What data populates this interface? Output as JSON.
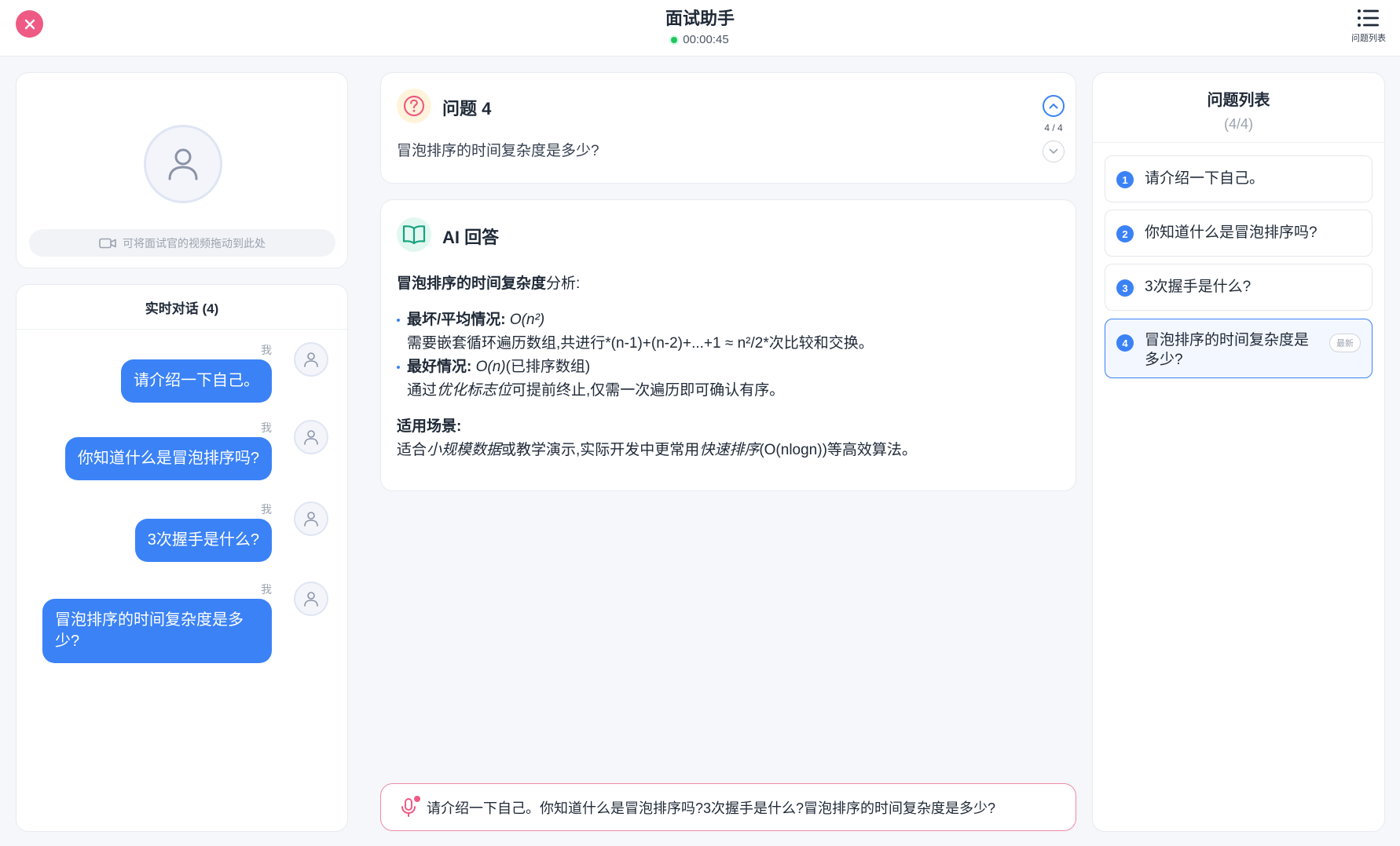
{
  "header": {
    "title": "面试助手",
    "timer": "00:00:45",
    "question_list_label": "问题列表"
  },
  "video": {
    "drag_hint": "可将面试官的视频拖动到此处"
  },
  "chat": {
    "title": "实时对话 (4)",
    "messages": [
      {
        "sender": "我",
        "text": "请介绍一下自己。"
      },
      {
        "sender": "我",
        "text": "你知道什么是冒泡排序吗?"
      },
      {
        "sender": "我",
        "text": "3次握手是什么?"
      },
      {
        "sender": "我",
        "text_line1": "冒泡排序的时间复杂度是多",
        "text_line2": "少?"
      }
    ]
  },
  "question": {
    "title": "问题 4",
    "text": "冒泡排序的时间复杂度是多少?",
    "position": "4 / 4"
  },
  "answer": {
    "title": "AI 回答",
    "intro_bold": "冒泡排序的时间复杂度",
    "intro_rest": "分析:",
    "worst_label": "最坏/平均情况:",
    "worst_value": "O(n²)",
    "worst_desc": "需要嵌套循环遍历数组,共进行*(n-1)+(n-2)+...+1 ≈ n²/2*次比较和交换。",
    "best_label": "最好情况:",
    "best_value": "O(n)",
    "best_note": "(已排序数组)",
    "best_desc_pre": "通过",
    "best_desc_em": "优化标志位",
    "best_desc_post": "可提前终止,仅需一次遍历即可确认有序。",
    "scene_label": "适用场景:",
    "scene_pre": "适合",
    "scene_em1": "小规模数据",
    "scene_mid": "或教学演示,实际开发中更常用",
    "scene_em2": "快速排序",
    "scene_post": "(O(nlogn))等高效算法。"
  },
  "transcript": {
    "text": "请介绍一下自己。你知道什么是冒泡排序吗?3次握手是什么?冒泡排序的时间复杂度是多少?"
  },
  "question_list": {
    "title": "问题列表",
    "count": "(4/4)",
    "items": [
      {
        "num": "1",
        "label": "请介绍一下自己。"
      },
      {
        "num": "2",
        "label": "你知道什么是冒泡排序吗?"
      },
      {
        "num": "3",
        "label": "3次握手是什么?"
      },
      {
        "num": "4",
        "label_line1": "冒泡排序的时间复杂度是",
        "label_line2": "多少?",
        "badge": "最新"
      }
    ]
  },
  "colors": {
    "accent": "#3b82f6",
    "close": "#ef5a84",
    "timer_dot": "#22c55e",
    "question_icon_bg": "#fff4db",
    "answer_icon_bg": "#e3f7f1"
  },
  "icons": [
    "close-icon",
    "menu-list-icon",
    "user-icon",
    "video-camera-icon",
    "question-circle-icon",
    "chevron-up-icon",
    "chevron-down-icon",
    "book-open-icon",
    "microphone-icon"
  ]
}
